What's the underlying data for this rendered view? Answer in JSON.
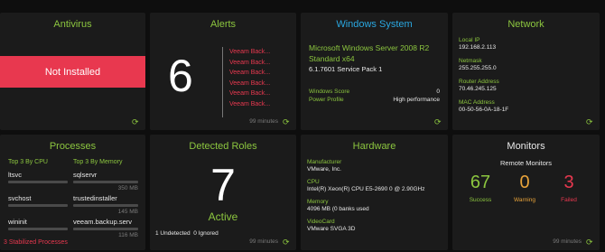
{
  "antivirus": {
    "title": "Antivirus",
    "status": "Not Installed"
  },
  "alerts": {
    "title": "Alerts",
    "count": "6",
    "items": [
      "Veeam Back...",
      "Veeam Back...",
      "Veeam Back...",
      "Veeam Back...",
      "Veeam Back...",
      "Veeam Back..."
    ],
    "age": "99 minutes"
  },
  "windows": {
    "title": "Windows System",
    "os": "Microsoft Windows Server 2008 R2 Standard x64",
    "build": "6.1.7601 Service Pack 1",
    "score_label": "Windows Score",
    "score_value": "0",
    "power_label": "Power Profile",
    "power_value": "High performance"
  },
  "network": {
    "title": "Network",
    "local_ip_label": "Local IP",
    "local_ip": "192.168.2.113",
    "netmask_label": "Netmask",
    "netmask": "255.255.255.0",
    "router_label": "Router Address",
    "router": "70.46.245.125",
    "mac_label": "MAC Address",
    "mac": "00-50-56-0A-18-1F"
  },
  "processes": {
    "title": "Processes",
    "cpu_header": "Top 3 By CPU",
    "mem_header": "Top 3 By Memory",
    "cpu": [
      "ltsvc",
      "svchost",
      "wininit"
    ],
    "mem": [
      {
        "name": "sqlservr",
        "size": "350 MB"
      },
      {
        "name": "trustedinstaller",
        "size": "145 MB"
      },
      {
        "name": "veeam.backup.serv",
        "size": "116 MB"
      }
    ],
    "footer": "3 Stabilized Processes"
  },
  "roles": {
    "title": "Detected Roles",
    "count": "7",
    "state": "Active",
    "summary": "1 Undetected  0 Ignored",
    "age": "99 minutes"
  },
  "hardware": {
    "title": "Hardware",
    "manufacturer_label": "Manufacturer",
    "manufacturer": "VMware, Inc.",
    "cpu_label": "CPU",
    "cpu": "Intel(R) Xeon(R) CPU E5-2690 0 @ 2.90GHz",
    "memory_label": "Memory",
    "memory": "4096 MB (0 banks used",
    "video_label": "VideoCard",
    "video": "VMware SVGA 3D"
  },
  "monitors": {
    "title": "Monitors",
    "subtitle": "Remote Monitors",
    "success_count": "67",
    "success_label": "Success",
    "warning_count": "0",
    "warning_label": "Warning",
    "failed_count": "3",
    "failed_label": "Failed",
    "age": "99 minutes"
  },
  "colors": {
    "accent_green": "#8cc63f",
    "danger": "#e8384f",
    "windows_blue": "#2aa7e0",
    "warning": "#e8a33a",
    "failed": "#e8384f"
  }
}
